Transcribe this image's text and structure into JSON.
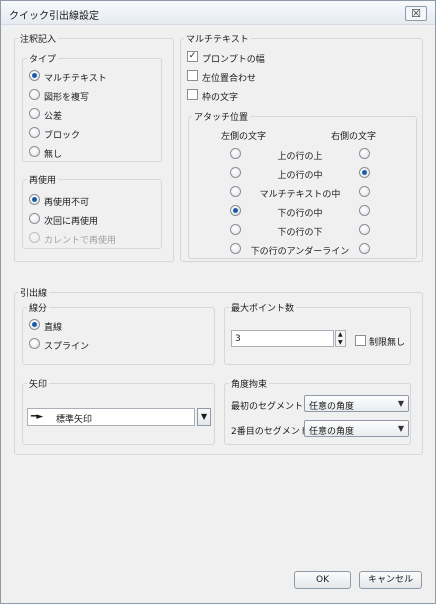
{
  "window": {
    "title": "クイック引出線設定",
    "close_glyph": "☒"
  },
  "annotation": {
    "label": "注釈記入",
    "type": {
      "label": "タイプ",
      "options": [
        {
          "label": "マルチテキスト",
          "selected": true
        },
        {
          "label": "図形を複写",
          "selected": false
        },
        {
          "label": "公差",
          "selected": false
        },
        {
          "label": "ブロック",
          "selected": false
        },
        {
          "label": "無し",
          "selected": false
        }
      ]
    },
    "reuse": {
      "label": "再使用",
      "options": [
        {
          "label": "再使用不可",
          "selected": true
        },
        {
          "label": "次回に再使用",
          "selected": false
        },
        {
          "label": "カレントで再使用",
          "selected": false,
          "disabled": true
        }
      ]
    }
  },
  "mtext": {
    "label": "マルチテキスト",
    "checks": [
      {
        "label": "プロンプトの幅",
        "checked": true
      },
      {
        "label": "左位置合わせ",
        "checked": false
      },
      {
        "label": "枠の文字",
        "checked": false
      }
    ],
    "attach": {
      "label": "アタッチ位置",
      "left_header": "左側の文字",
      "right_header": "右側の文字",
      "rows": [
        {
          "label": "上の行の上",
          "left": false,
          "right": false
        },
        {
          "label": "上の行の中",
          "left": false,
          "right": true
        },
        {
          "label": "マルチテキストの中",
          "left": false,
          "right": false
        },
        {
          "label": "下の行の中",
          "left": true,
          "right": false
        },
        {
          "label": "下の行の下",
          "left": false,
          "right": false
        },
        {
          "label": "下の行のアンダーライン",
          "left": false,
          "right": false
        }
      ]
    }
  },
  "leader": {
    "label": "引出線",
    "line": {
      "label": "線分",
      "options": [
        {
          "label": "直線",
          "selected": true
        },
        {
          "label": "スプライン",
          "selected": false
        }
      ]
    },
    "maxpoints": {
      "label": "最大ポイント数",
      "value": "3",
      "unlimited_label": "制限無し",
      "unlimited_checked": false
    },
    "arrow": {
      "label": "矢印",
      "value": "標準矢印"
    },
    "angle": {
      "label": "角度拘束",
      "first_label": "最初のセグメント",
      "first_value": "任意の角度",
      "second_label": "2番目のセグメント",
      "second_value": "任意の角度"
    }
  },
  "buttons": {
    "ok": "OK",
    "cancel": "キャンセル"
  }
}
